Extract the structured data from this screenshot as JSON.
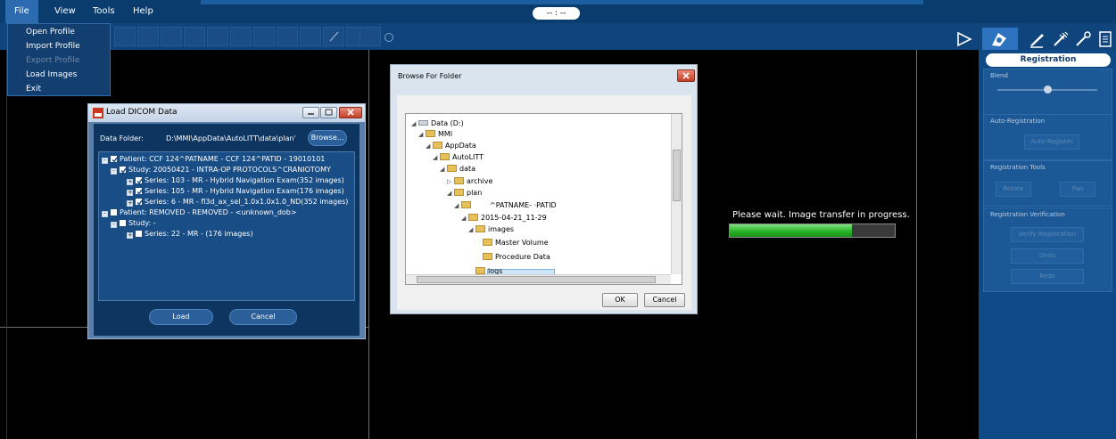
{
  "menubar": {
    "items": [
      "File",
      "View",
      "Tools",
      "Help"
    ],
    "timer": "-- : --"
  },
  "file_menu": {
    "items": [
      {
        "label": "Open Profile",
        "enabled": true
      },
      {
        "label": "Import Profile",
        "enabled": true
      },
      {
        "label": "Export Profile",
        "enabled": false
      },
      {
        "label": "Load Images",
        "enabled": true
      },
      {
        "label": "Exit",
        "enabled": true
      }
    ]
  },
  "dicom_dialog": {
    "title": "Load DICOM Data",
    "data_folder_label": "Data Folder:",
    "data_folder_value": "D:\\MMI\\AppData\\AutoLITT\\data\\plan'",
    "browse_label": "Browse...",
    "tree": [
      {
        "text": "Patient: CCF 124^PATNAME - CCF 124^PATID - 19010101",
        "checked": true,
        "level": 0
      },
      {
        "text": "Study: 20050421 - INTRA-OP PROTOCOLS^CRANIOTOMY",
        "checked": true,
        "level": 1
      },
      {
        "text": "Series: 103 - MR - Hybrid Navigation Exam(352 images)",
        "checked": true,
        "level": 2
      },
      {
        "text": "Series: 105 - MR - Hybrid Navigation Exam(176 images)",
        "checked": true,
        "level": 2
      },
      {
        "text": "Series: 6 - MR - fl3d_ax_sel_1.0x1.0x1.0_ND(352 images)",
        "checked": true,
        "level": 2
      },
      {
        "text": "Patient: REMOVED - REMOVED - <unknown_dob>",
        "checked": false,
        "level": 0
      },
      {
        "text": "Study: -",
        "checked": false,
        "level": 1
      },
      {
        "text": "Series: 22 - MR - (176 images)",
        "checked": false,
        "level": 2
      }
    ],
    "load_label": "Load",
    "cancel_label": "Cancel"
  },
  "browse_dialog": {
    "title": "Browse For Folder",
    "tree": [
      {
        "text": "Data (D:)",
        "level": 0,
        "icon": "drive-icon",
        "expander": "open"
      },
      {
        "text": "MMI",
        "level": 1,
        "icon": "folder-icon",
        "expander": "open"
      },
      {
        "text": "AppData",
        "level": 2,
        "icon": "folder-icon",
        "expander": "open"
      },
      {
        "text": "AutoLITT",
        "level": 3,
        "icon": "folder-icon",
        "expander": "open"
      },
      {
        "text": "data",
        "level": 4,
        "icon": "folder-icon",
        "expander": "open"
      },
      {
        "text": "archive",
        "level": 5,
        "icon": "folder-icon",
        "expander": "closed"
      },
      {
        "text": "plan",
        "level": 5,
        "icon": "folder-icon",
        "expander": "open"
      },
      {
        "text": "^PATNAME-            ·PATID",
        "level": 6,
        "icon": "folder-icon",
        "expander": "open"
      },
      {
        "text": "2015-04-21_11-29",
        "level": 7,
        "icon": "folder-icon",
        "expander": "open"
      },
      {
        "text": "images",
        "level": 8,
        "icon": "folder-icon",
        "expander": "open"
      },
      {
        "text": "Master Volume",
        "level": 9,
        "icon": "folder-icon",
        "expander": "none"
      },
      {
        "text": "Procedure Data",
        "level": 9,
        "icon": "folder-icon",
        "expander": "none",
        "selected": true
      },
      {
        "text": "logs",
        "level": 8,
        "icon": "folder-icon",
        "expander": "none"
      }
    ],
    "ok_label": "OK",
    "cancel_label": "Cancel"
  },
  "progress": {
    "message": "Please wait. Image transfer in progress.",
    "value": 0.74,
    "fill_color": "#23b123"
  },
  "right_panel": {
    "header": "Registration",
    "blend_label": "Blend",
    "blend_value": 0.5,
    "auto_registration_label": "Auto-Registration",
    "auto_register_button": "Auto-Register",
    "registration_tools_label": "Registration Tools",
    "rotate_button": "Rotate",
    "pan_button": "Pan",
    "verification_label": "Registration Verification",
    "verify_button": "Verify Registration",
    "undo_button": "Undo",
    "redo_button": "Redo"
  },
  "toolbar_icons": [
    "play-icon",
    "registration-icon",
    "plan-icon",
    "ablation-icon",
    "tool-icon",
    "report-icon"
  ],
  "colors": {
    "menubar": "#0a3c6e",
    "panel": "#0f4a86",
    "accent": "#1b5fa0"
  }
}
